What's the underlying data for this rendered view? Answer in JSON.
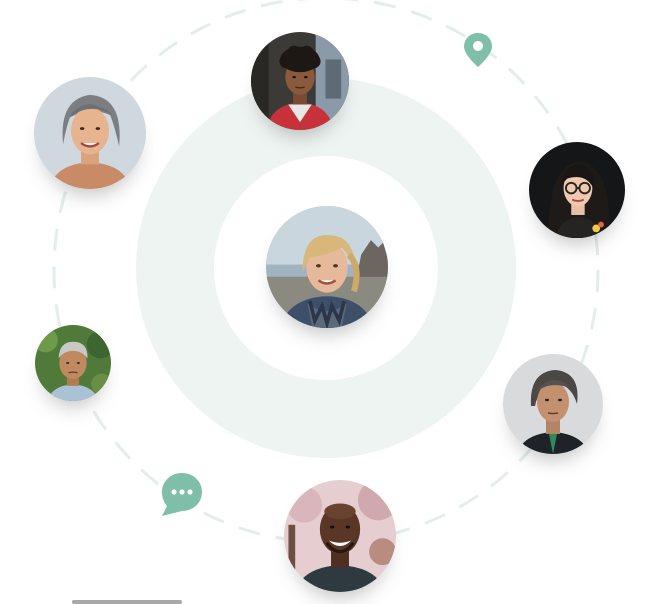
{
  "colors": {
    "accent": "#7fbfa9",
    "ring_fill": "#eef4f1",
    "orbit_stroke": "#e3eeea"
  },
  "icons": {
    "location": "map-pin-icon",
    "message": "chat-bubble-icon"
  },
  "avatars": [
    {
      "name": "avatar-center-woman"
    },
    {
      "name": "avatar-young-man"
    },
    {
      "name": "avatar-older-woman"
    },
    {
      "name": "avatar-woman-glasses"
    },
    {
      "name": "avatar-older-man"
    },
    {
      "name": "avatar-woman-gray-hair"
    },
    {
      "name": "avatar-smiling-man"
    }
  ]
}
